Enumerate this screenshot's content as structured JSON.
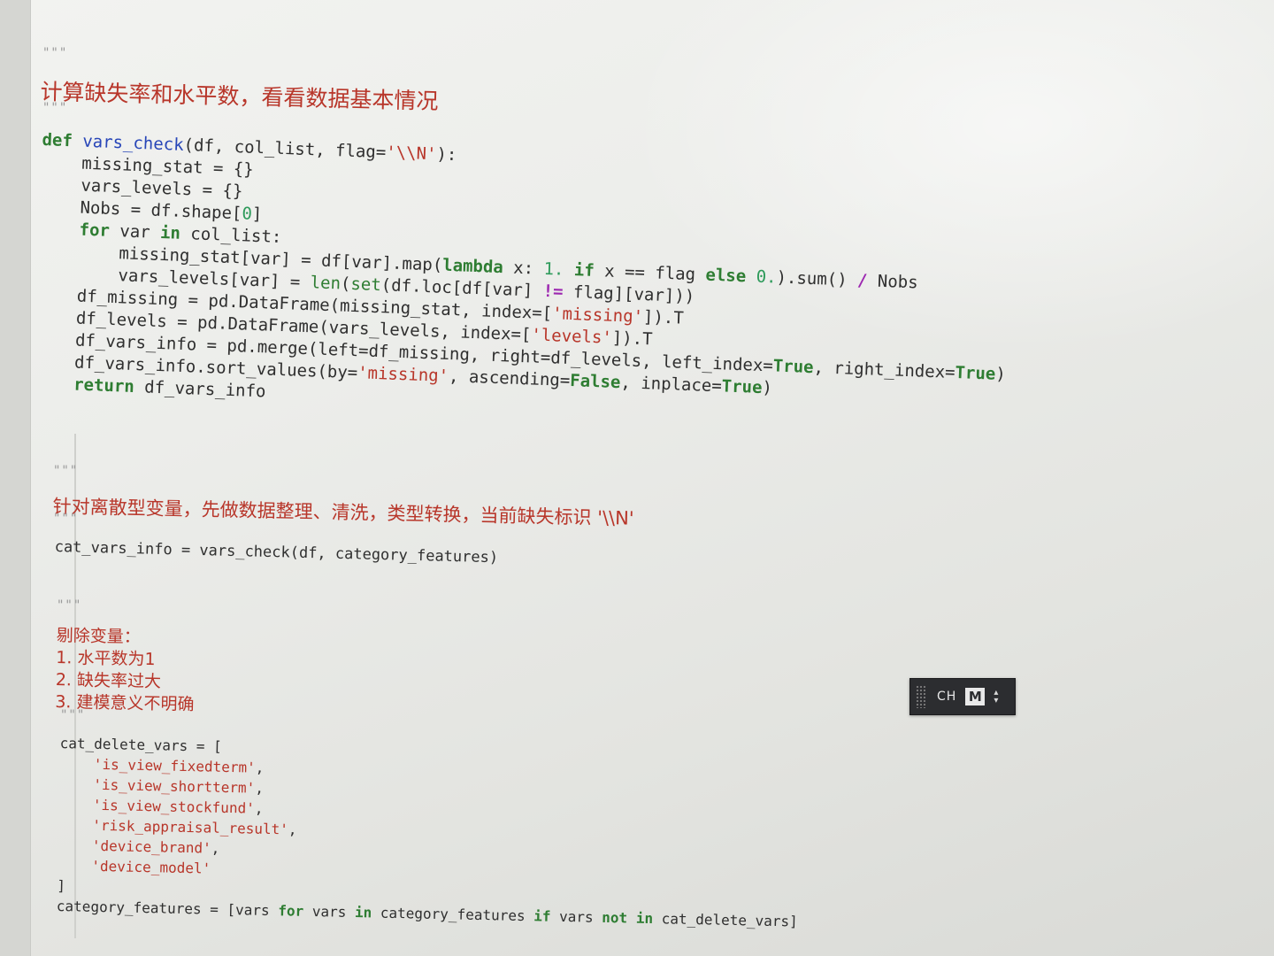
{
  "ime": {
    "language": "CH",
    "mode": "M",
    "grip_icon": "drag-handle-icon",
    "menu_icon": "up-down-arrows-icon"
  },
  "quote_mark": "\"\"\"",
  "section1": {
    "comment": "计算缺失率和水平数，看看数据基本情况"
  },
  "section2": {
    "comment": "针对离散型变量，先做数据整理、清洗，类型转换，当前缺失标识 '\\\\N'",
    "code": "cat_vars_info = vars_check(df, category_features)"
  },
  "section3": {
    "comment_lines": [
      "剔除变量：",
      "1. 水平数为1",
      "2. 缺失率过大",
      "3. 建模意义不明确"
    ]
  },
  "colors": {
    "keyword": "#2e7d32",
    "function": "#2846b8",
    "string": "#b8362a",
    "comment": "#b8362a",
    "ime_background": "#2c2d30"
  }
}
